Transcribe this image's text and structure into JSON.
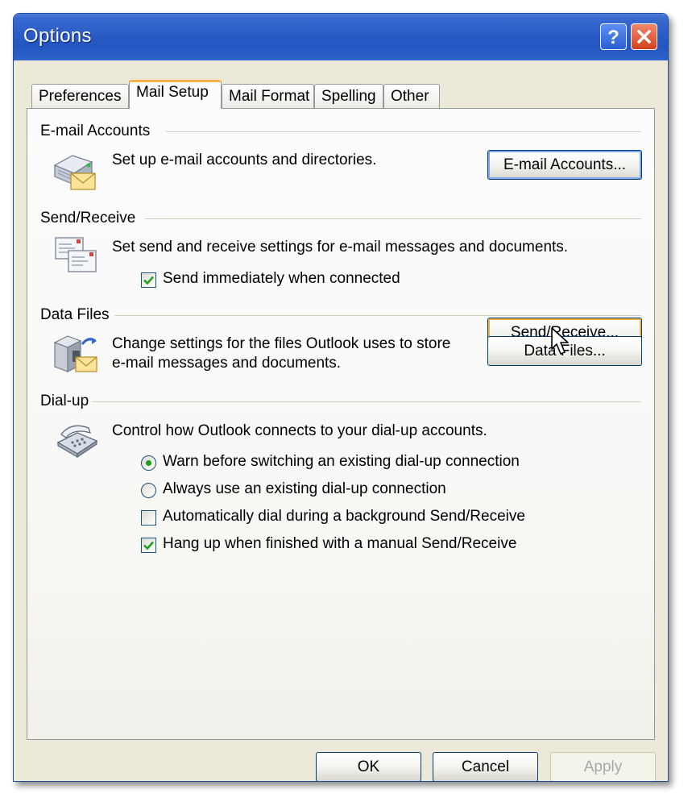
{
  "window": {
    "title": "Options"
  },
  "tabs": [
    {
      "label": "Preferences",
      "active": false
    },
    {
      "label": "Mail Setup",
      "active": true
    },
    {
      "label": "Mail Format",
      "active": false
    },
    {
      "label": "Spelling",
      "active": false
    },
    {
      "label": "Other",
      "active": false
    }
  ],
  "email_accounts": {
    "heading": "E-mail Accounts",
    "description": "Set up e-mail accounts and directories.",
    "button": "E-mail Accounts..."
  },
  "send_receive": {
    "heading": "Send/Receive",
    "description": "Set send and receive settings for e-mail messages and documents.",
    "send_immediately": {
      "label": "Send immediately when connected",
      "checked": true
    },
    "button": "Send/Receive..."
  },
  "data_files": {
    "heading": "Data Files",
    "description_line1": "Change settings for the files Outlook uses to store",
    "description_line2": "e-mail messages and documents.",
    "button": "Data Files..."
  },
  "dialup": {
    "heading": "Dial-up",
    "description": "Control how Outlook connects to your dial-up accounts.",
    "option_warn": {
      "label": "Warn before switching an existing dial-up connection",
      "selected": true
    },
    "option_always": {
      "label": "Always use an existing dial-up connection",
      "selected": false
    },
    "auto_dial": {
      "label": "Automatically dial during a background Send/Receive",
      "checked": false
    },
    "hang_up": {
      "label": "Hang up when finished with a manual Send/Receive",
      "checked": true
    }
  },
  "footer": {
    "ok": "OK",
    "cancel": "Cancel",
    "apply": "Apply"
  },
  "colors": {
    "title_bar": "#2a5cc6",
    "active_tab_accent": "#f7b24a",
    "check_mark": "#21a121"
  }
}
